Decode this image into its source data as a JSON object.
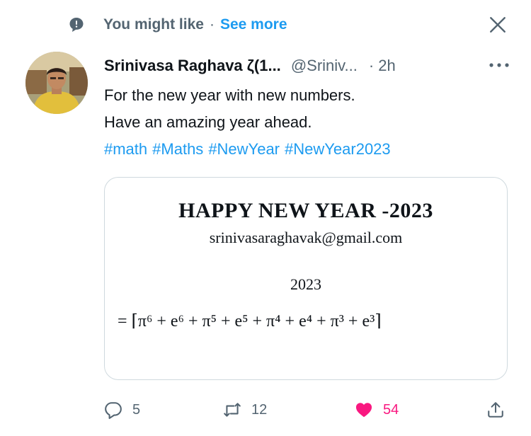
{
  "context": {
    "label": "You might like",
    "separator": "·",
    "link": "See more"
  },
  "tweet": {
    "display_name": "Srinivasa Raghava ζ(1...",
    "handle": "@Sriniv...",
    "separator": "·",
    "time": "2h",
    "lines": [
      "For the new year with new numbers.",
      "Have an amazing year ahead."
    ],
    "hashtags": [
      "#math",
      "#Maths",
      "#NewYear",
      "#NewYear2023"
    ]
  },
  "media": {
    "title": "HAPPY NEW YEAR -2023",
    "email": "srinivasaraghavak@gmail.com",
    "year": "2023",
    "formula": "= ⌈π⁶ + e⁶ + π⁵ + e⁵ + π⁴ + e⁴ + π³ + e³⌉"
  },
  "actions": {
    "reply_count": "5",
    "retweet_count": "12",
    "like_count": "54",
    "like_color": "#f91880"
  },
  "icons": {
    "context": "speech-bubble-icon",
    "close": "close-icon",
    "more": "more-options-icon",
    "reply": "reply-icon",
    "retweet": "retweet-icon",
    "like": "heart-icon",
    "share": "share-icon"
  }
}
